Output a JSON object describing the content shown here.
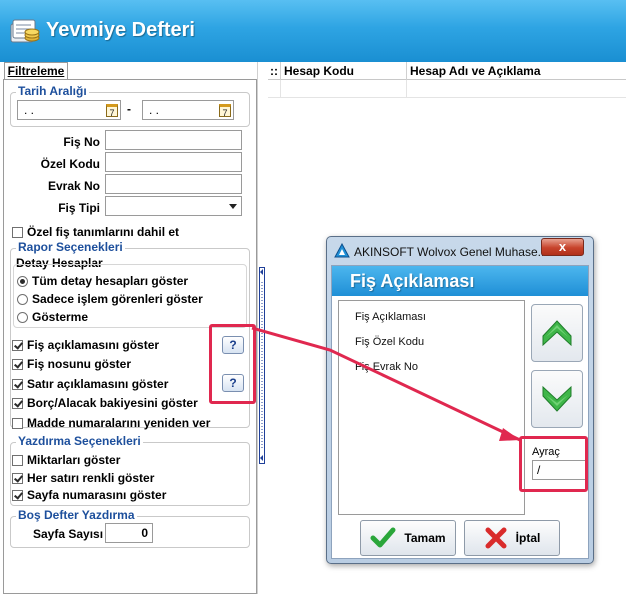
{
  "app": {
    "title": "Yevmiye Defteri",
    "title_bar_color": "#2ea4e3"
  },
  "tab": {
    "label": "Filtreleme"
  },
  "filters": {
    "date_range": {
      "title": "Tarih Aralığı",
      "start_value": ". .",
      "separator": "-",
      "end_value": ". .",
      "calendar_icon": "calendar-icon"
    },
    "fis_no_label": "Fiş No",
    "ozel_kodu_label": "Özel Kodu",
    "evrak_no_label": "Evrak No",
    "fis_tipi_label": "Fiş Tipi",
    "include_special": {
      "label": "Özel fiş tanımlarını dahil et",
      "checked": false
    }
  },
  "report_options": {
    "title": "Rapor Seçenekleri",
    "detail_accounts": {
      "title": "Detay Hesaplar",
      "options": [
        {
          "label": "Tüm detay hesapları göster",
          "selected": true
        },
        {
          "label": "Sadece işlem görenleri göster",
          "selected": false
        },
        {
          "label": "Gösterme",
          "selected": false
        }
      ]
    },
    "checks": [
      {
        "label": "Fiş açıklamasını göster",
        "checked": true
      },
      {
        "label": "Fiş nosunu göster",
        "checked": true
      },
      {
        "label": "Satır açıklamasını göster",
        "checked": true
      },
      {
        "label": "Borç/Alacak bakiyesini göster",
        "checked": true
      },
      {
        "label": "Madde numaralarını yeniden ver",
        "checked": false
      }
    ],
    "help_button_label": "?"
  },
  "print_options": {
    "title": "Yazdırma Seçenekleri",
    "checks": [
      {
        "label": "Miktarları göster",
        "checked": false
      },
      {
        "label": "Her satırı renkli göster",
        "checked": true
      },
      {
        "label": "Sayfa numarasını göster",
        "checked": true
      }
    ]
  },
  "blank_print": {
    "title": "Boş Defter Yazdırma",
    "page_count_label": "Sayfa Sayısı",
    "page_count_value": "0"
  },
  "grid": {
    "corner": "::",
    "columns": [
      "Hesap Kodu",
      "Hesap Adı ve Açıklama"
    ]
  },
  "dialog": {
    "window_title": "AKINSOFT Wolvox Genel Muhase...",
    "close_label": "x",
    "header": "Fiş Açıklaması",
    "header_color": "#1f8fd6",
    "items": [
      "Fiş Açıklaması",
      "Fiş Özel Kodu",
      "Fiş Evrak No"
    ],
    "separator_label": "Ayraç",
    "separator_value": "/",
    "ok_label": "Tamam",
    "cancel_label": "İptal",
    "move_up_icon": "chevron-up-icon",
    "move_down_icon": "chevron-down-icon"
  },
  "annotation": {
    "color": "#e0284f"
  }
}
